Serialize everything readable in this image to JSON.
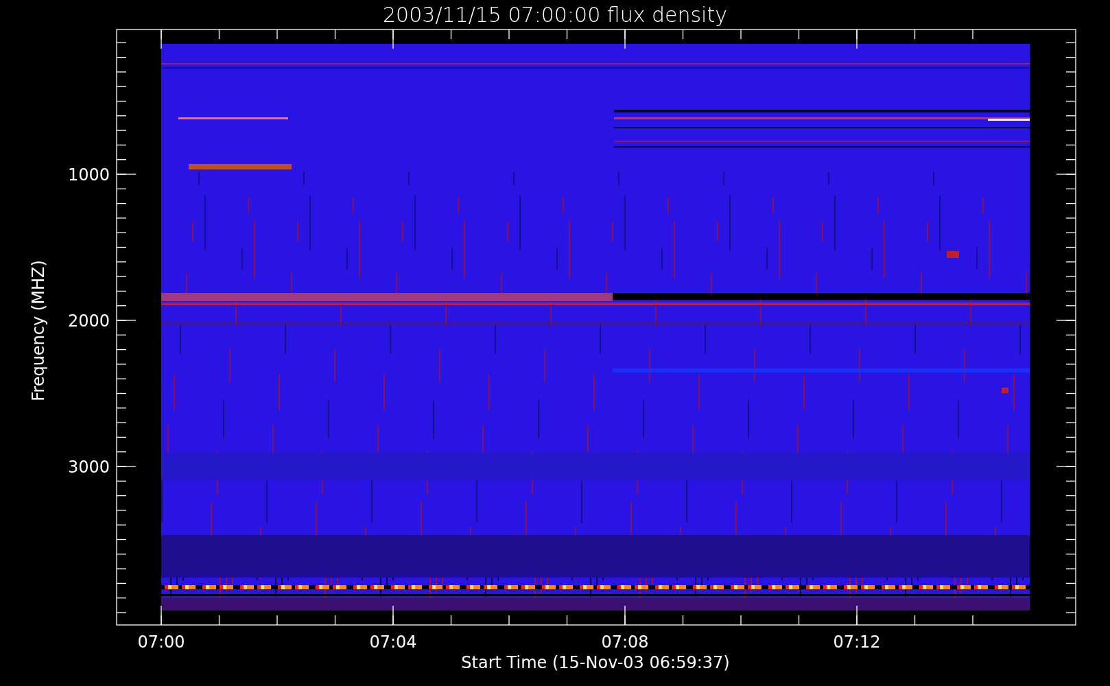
{
  "title": "2003/11/15 07:00:00 flux density",
  "y_axis": {
    "label": "Frequency (MHZ)",
    "ticks": [
      "1000",
      "2000",
      "3000"
    ]
  },
  "x_axis": {
    "label": "Start Time (15-Nov-03 06:59:37)",
    "ticks": [
      "07:00",
      "07:04",
      "07:08",
      "07:12"
    ]
  }
}
